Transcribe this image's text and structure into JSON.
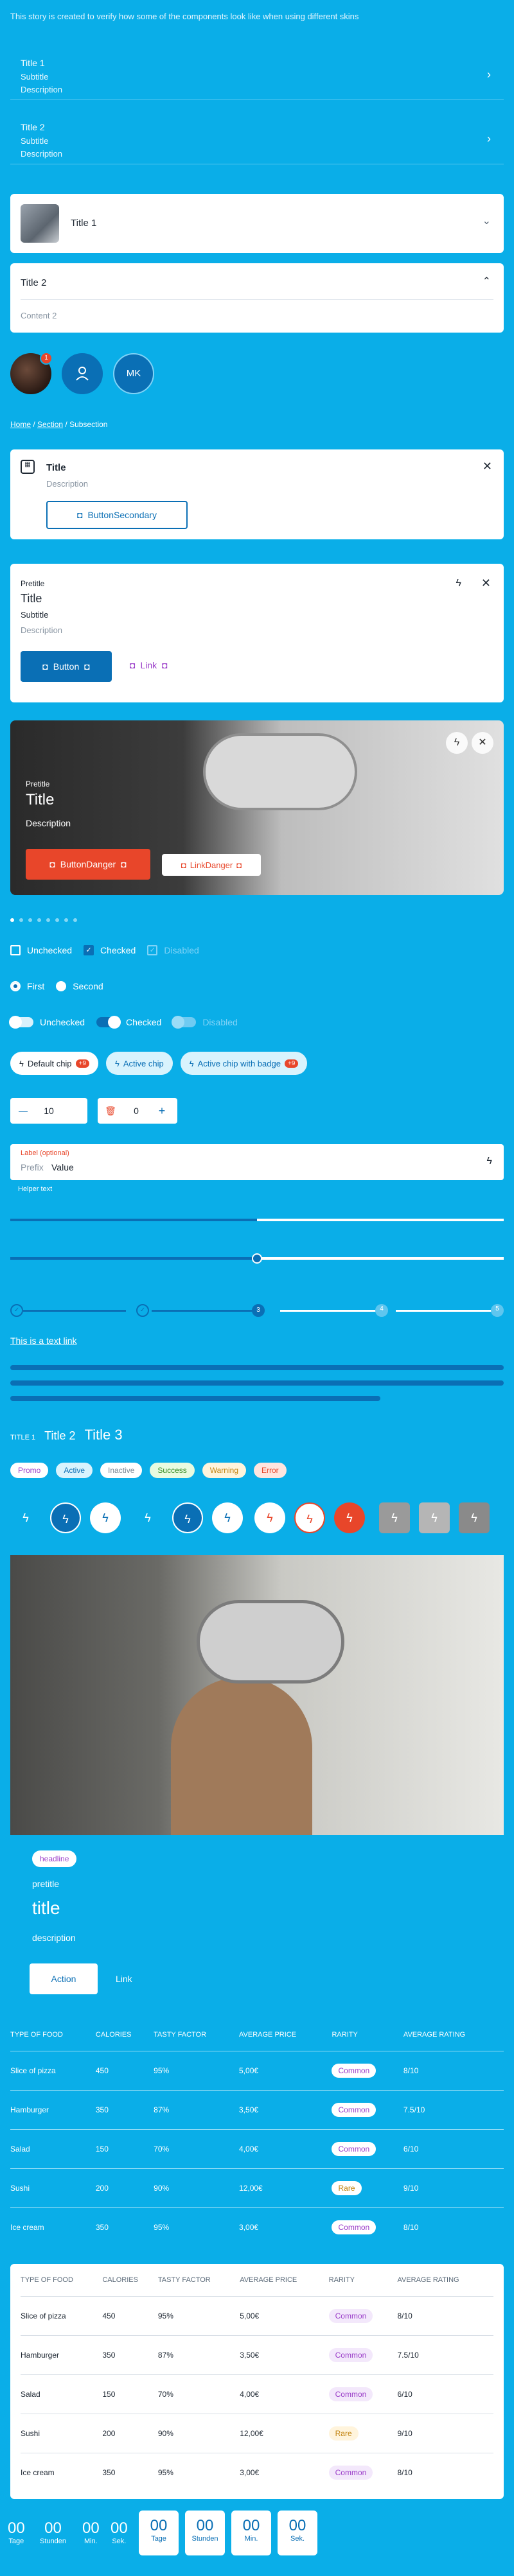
{
  "intro": "This story is created to verify how some of the components look like when using different skins",
  "list_items": [
    {
      "title": "Title 1",
      "subtitle": "Subtitle",
      "description": "Description"
    },
    {
      "title": "Title 2",
      "subtitle": "Subtitle",
      "description": "Description"
    }
  ],
  "accordion1": {
    "title": "Title 1"
  },
  "accordion2": {
    "title": "Title 2",
    "content": "Content 2"
  },
  "avatars": {
    "badge": "1",
    "initials": "MK"
  },
  "breadcrumb": {
    "home": "Home",
    "section": "Section",
    "current": "Subsection"
  },
  "notification": {
    "title": "Title",
    "description": "Description",
    "button": "ButtonSecondary"
  },
  "card": {
    "pretitle": "Pretitle",
    "title": "Title",
    "subtitle": "Subtitle",
    "description": "Description",
    "button": "Button",
    "link": "Link"
  },
  "hero": {
    "pretitle": "Pretitle",
    "title": "Title",
    "description": "Description",
    "button": "ButtonDanger",
    "link": "LinkDanger"
  },
  "checkboxes": {
    "unchecked": "Unchecked",
    "checked": "Checked",
    "disabled": "Disabled"
  },
  "radios": {
    "first": "First",
    "second": "Second"
  },
  "switches": {
    "unchecked": "Unchecked",
    "checked": "Checked",
    "disabled": "Disabled"
  },
  "chips": {
    "default": "Default chip",
    "default_count": "+9",
    "active": "Active chip",
    "badge": "Active chip with badge",
    "badge_count": "+9"
  },
  "steppers": {
    "first_value": "10",
    "second_value": "0"
  },
  "input": {
    "label": "Label (optional)",
    "prefix": "Prefix",
    "value": "Value",
    "helper": "Helper text"
  },
  "progress": {
    "fill": 0.5,
    "slider": 0.5
  },
  "stepper_steps": {
    "current": "3",
    "step4": "4",
    "step5": "5"
  },
  "text_link": "This is a text link",
  "headings": {
    "h1": "TITLE 1",
    "h2": "Title 2",
    "h3": "Title 3"
  },
  "badges": [
    "Promo",
    "Active",
    "Inactive",
    "Success",
    "Warning",
    "Error"
  ],
  "teaser": {
    "headline": "headline",
    "pretitle": "pretitle",
    "title": "title",
    "description": "description",
    "action": "Action",
    "link": "Link"
  },
  "table": {
    "headers": [
      "Type of food",
      "Calories",
      "Tasty factor",
      "Average price",
      "Rarity",
      "Average rating"
    ],
    "rows": [
      [
        "Slice of pizza",
        "450",
        "95%",
        "5,00€",
        "Common",
        "8/10"
      ],
      [
        "Hamburger",
        "350",
        "87%",
        "3,50€",
        "Common",
        "7.5/10"
      ],
      [
        "Salad",
        "150",
        "70%",
        "4,00€",
        "Common",
        "6/10"
      ],
      [
        "Sushi",
        "200",
        "90%",
        "12,00€",
        "Rare",
        "9/10"
      ],
      [
        "Ice cream",
        "350",
        "95%",
        "3,00€",
        "Common",
        "8/10"
      ]
    ]
  },
  "countdown": {
    "values": [
      "00",
      "00",
      "00",
      "00"
    ],
    "labels": [
      "Tage",
      "Stunden",
      "Min.",
      "Sek."
    ]
  },
  "colors": {
    "background": "#0aaee8",
    "primary": "#0a6fb5",
    "danger": "#e8462a",
    "accent": "#9b3ec9"
  }
}
